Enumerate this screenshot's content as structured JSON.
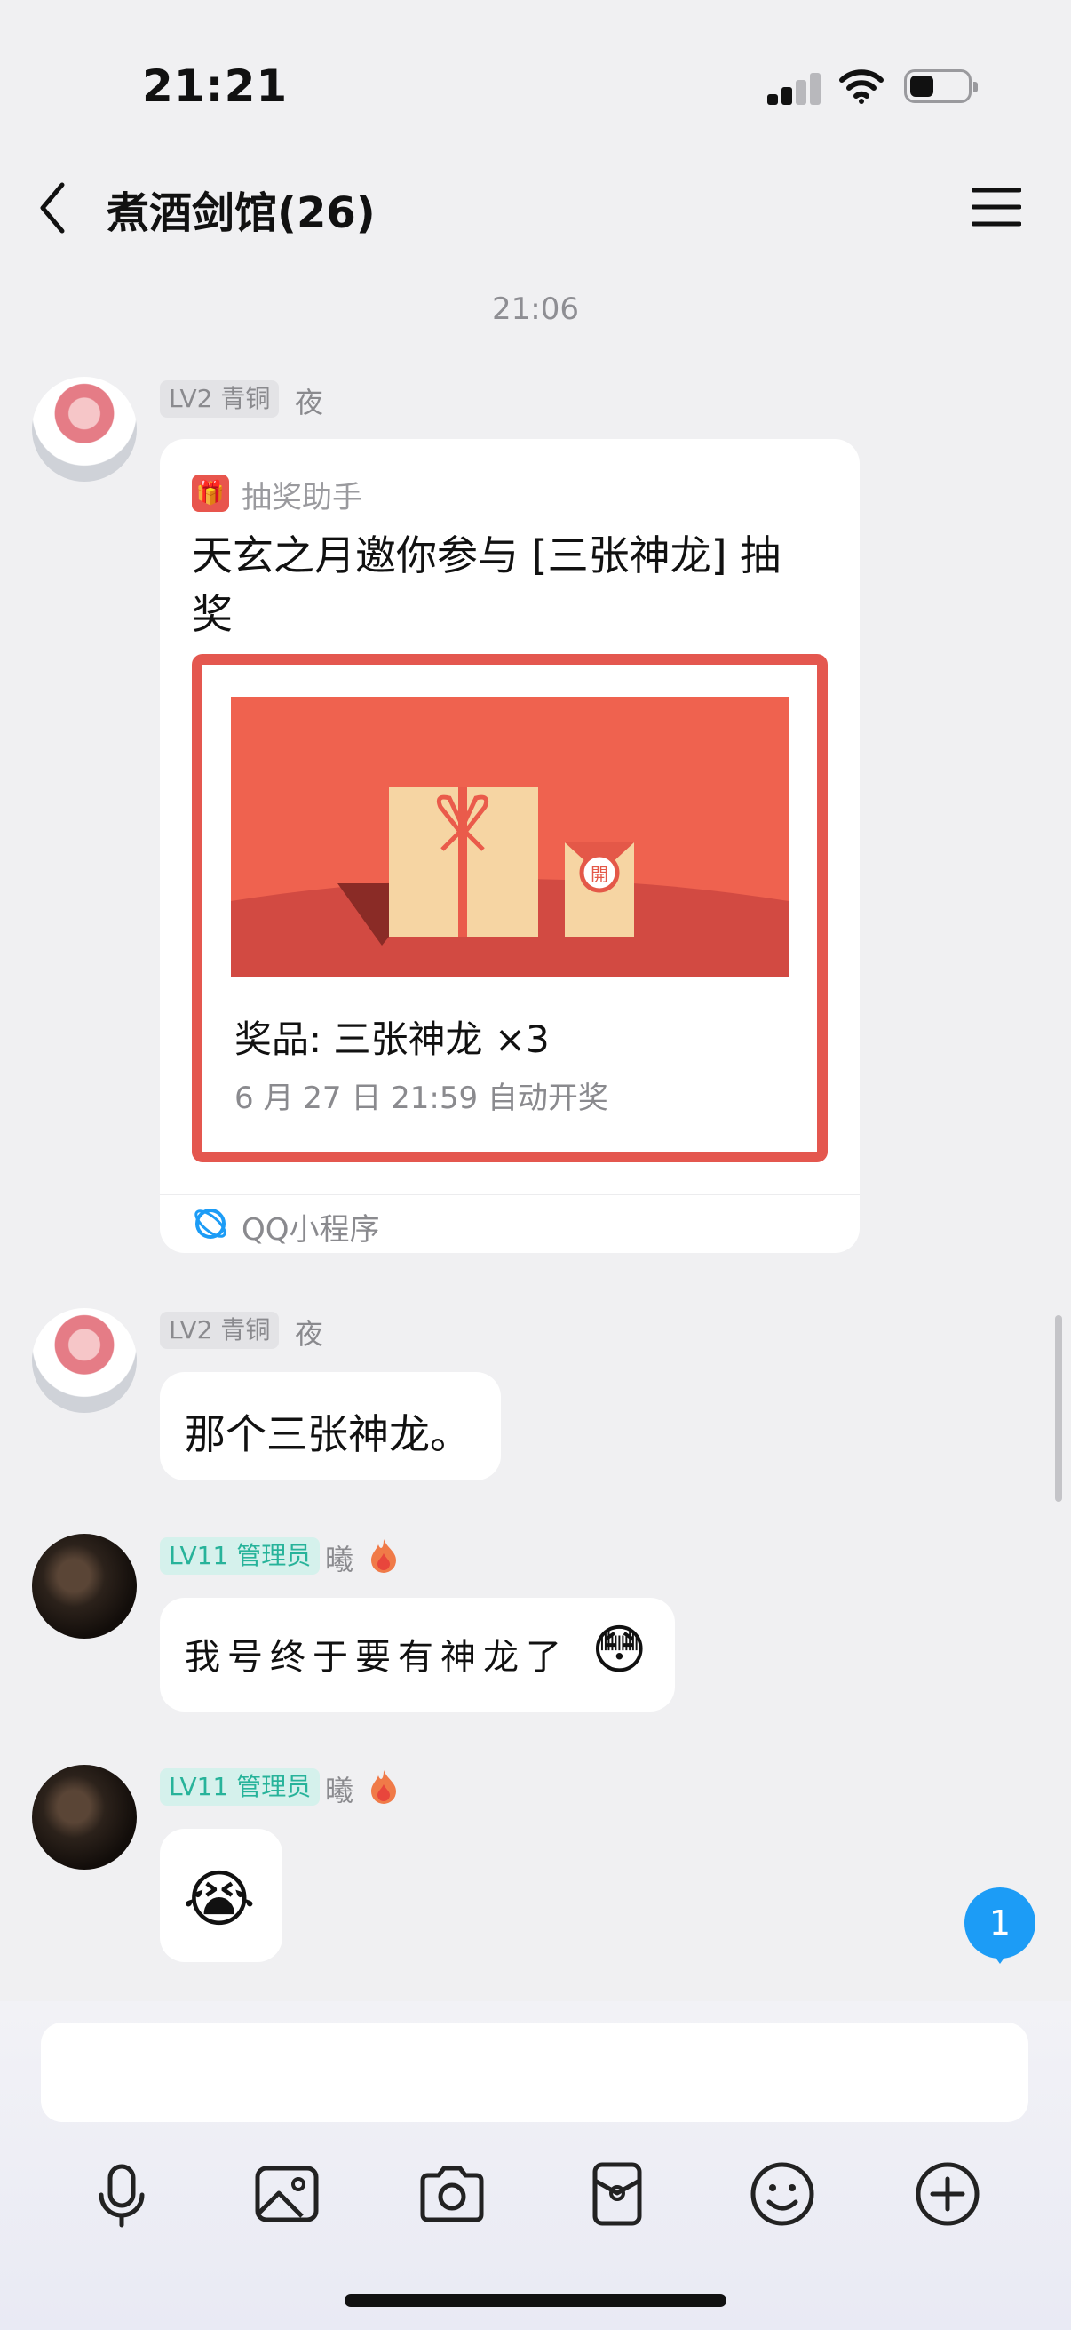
{
  "status_bar": {
    "time": "21:21"
  },
  "nav": {
    "title": "煮酒剑馆(26)"
  },
  "chat": {
    "timestamp": "21:06",
    "messages": [
      {
        "badge": "LV2 青铜",
        "sender": "夜",
        "card": {
          "source": "抽奖助手",
          "title": "天玄之月邀你参与 [三张神龙] 抽奖",
          "gift_seal": "開",
          "prize": "奖品: 三张神龙 ×3",
          "draw_time": "6 月 27 日 21:59 自动开奖",
          "mini_program": "QQ小程序"
        }
      },
      {
        "badge": "LV2 青铜",
        "sender": "夜",
        "text": "那个三张神龙。"
      },
      {
        "badge": "LV11 管理员",
        "sender": "曦",
        "text": "我号终于要有神龙了",
        "emoji": "😳"
      },
      {
        "badge": "LV11 管理员",
        "sender": "曦",
        "emoji": "😭"
      }
    ],
    "unread_count": "1"
  },
  "input": {
    "placeholder": ""
  },
  "toolbar": {
    "icons": [
      "microphone-icon",
      "image-icon",
      "camera-icon",
      "red-packet-icon",
      "emoji-icon",
      "plus-icon"
    ]
  },
  "colors": {
    "accent_red": "#e4574f",
    "admin_teal": "#27b39a",
    "unread_blue": "#1c9cf6"
  }
}
